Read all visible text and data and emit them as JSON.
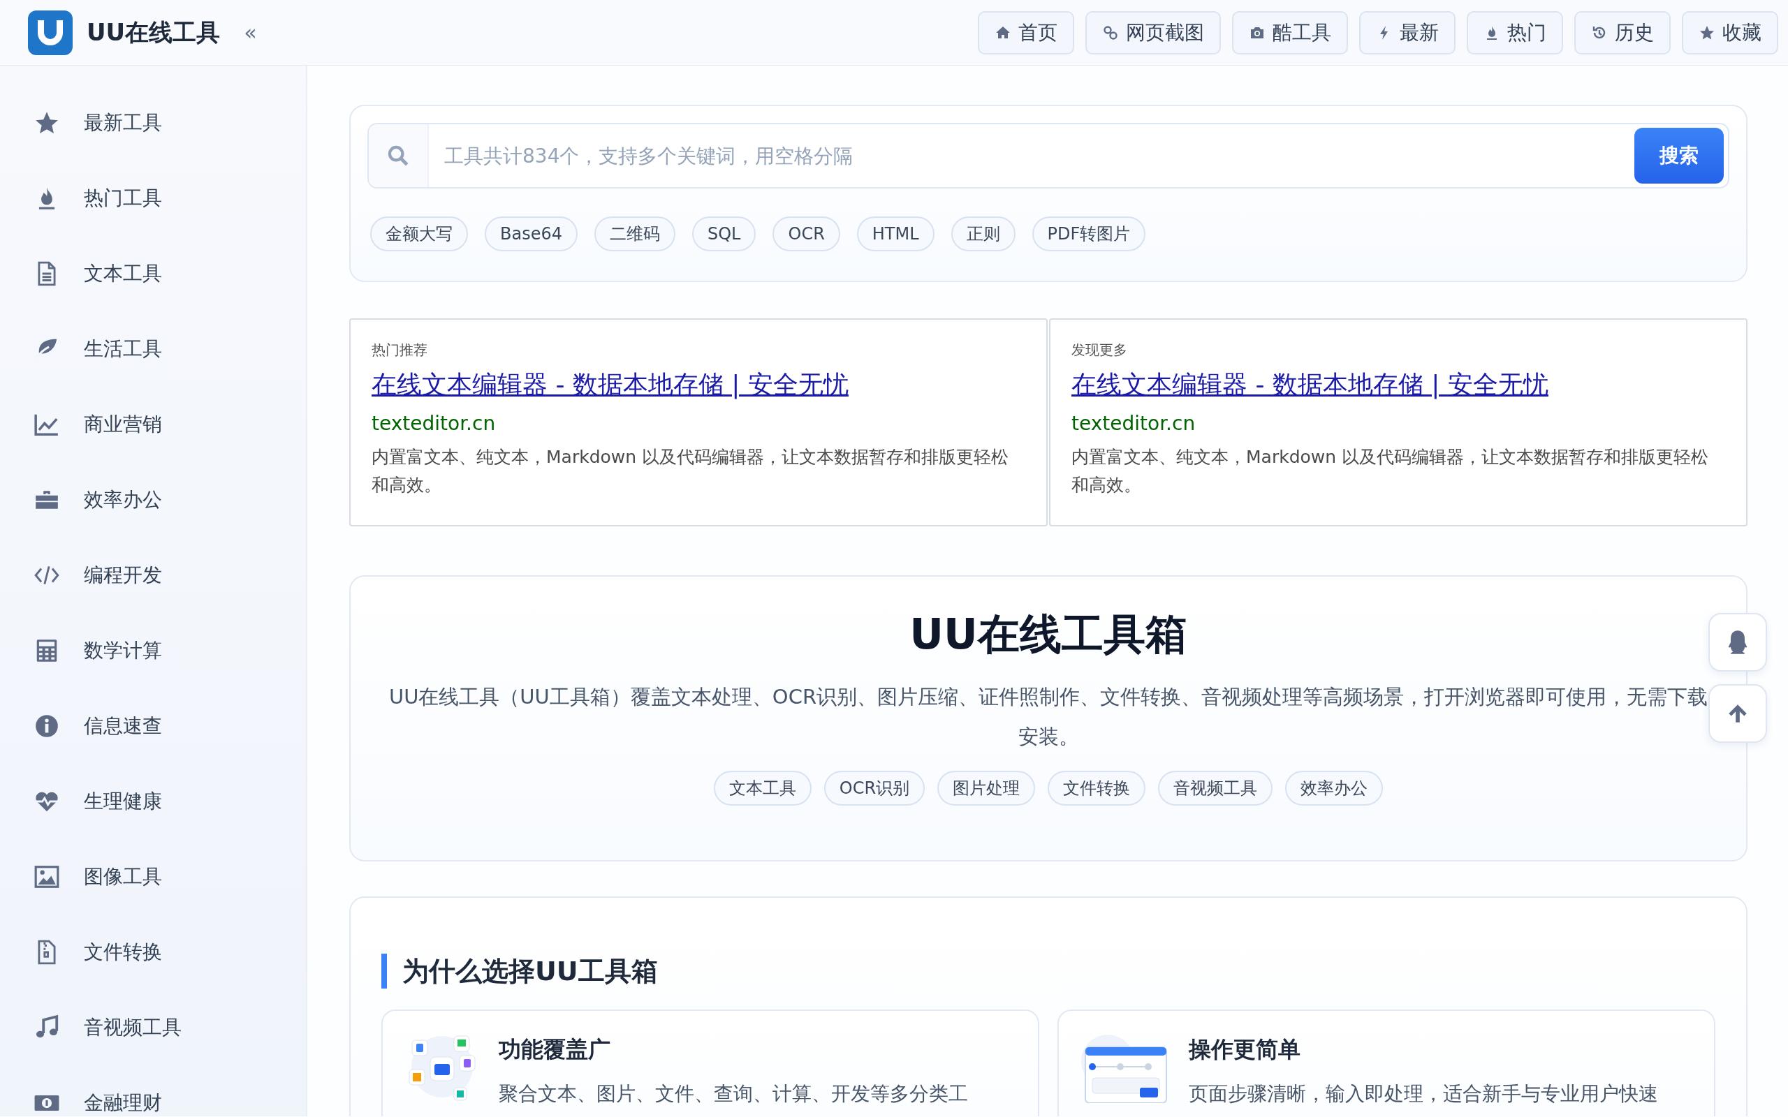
{
  "header": {
    "logo_text": "UU在线工具",
    "collapse": "«",
    "nav": [
      {
        "label": "首页"
      },
      {
        "label": "网页截图"
      },
      {
        "label": "酷工具"
      },
      {
        "label": "最新"
      },
      {
        "label": "热门"
      },
      {
        "label": "历史"
      },
      {
        "label": "收藏"
      }
    ]
  },
  "sidebar": {
    "items": [
      {
        "label": "最新工具"
      },
      {
        "label": "热门工具"
      },
      {
        "label": "文本工具"
      },
      {
        "label": "生活工具"
      },
      {
        "label": "商业营销"
      },
      {
        "label": "效率办公"
      },
      {
        "label": "编程开发"
      },
      {
        "label": "数学计算"
      },
      {
        "label": "信息速查"
      },
      {
        "label": "生理健康"
      },
      {
        "label": "图像工具"
      },
      {
        "label": "文件转换"
      },
      {
        "label": "音视频工具"
      },
      {
        "label": "金融理财"
      }
    ]
  },
  "search": {
    "placeholder": "工具共计834个，支持多个关键词，用空格分隔",
    "button": "搜索",
    "tags": [
      "金额大写",
      "Base64",
      "二维码",
      "SQL",
      "OCR",
      "HTML",
      "正则",
      "PDF转图片"
    ]
  },
  "ads": [
    {
      "label": "热门推荐",
      "title": "在线文本编辑器 - 数据本地存储 | 安全无忧",
      "domain": "texteditor.cn",
      "description": "内置富文本、纯文本，Markdown 以及代码编辑器，让文本数据暂存和排版更轻松和高效。"
    },
    {
      "label": "发现更多",
      "title": "在线文本编辑器 - 数据本地存储 | 安全无忧",
      "domain": "texteditor.cn",
      "description": "内置富文本、纯文本，Markdown 以及代码编辑器，让文本数据暂存和排版更轻松和高效。"
    }
  ],
  "hero": {
    "title": "UU在线工具箱",
    "description": "UU在线工具（UU工具箱）覆盖文本处理、OCR识别、图片压缩、证件照制作、文件转换、音视频处理等高频场景，打开浏览器即可使用，无需下载安装。",
    "tags": [
      "文本工具",
      "OCR识别",
      "图片处理",
      "文件转换",
      "音视频工具",
      "效率办公"
    ]
  },
  "why": {
    "title": "为什么选择UU工具箱",
    "features": [
      {
        "title": "功能覆盖广",
        "description": "聚合文本、图片、文件、查询、计算、开发等多分类工"
      },
      {
        "title": "操作更简单",
        "description": "页面步骤清晰，输入即处理，适合新手与专业用户快速"
      }
    ]
  }
}
